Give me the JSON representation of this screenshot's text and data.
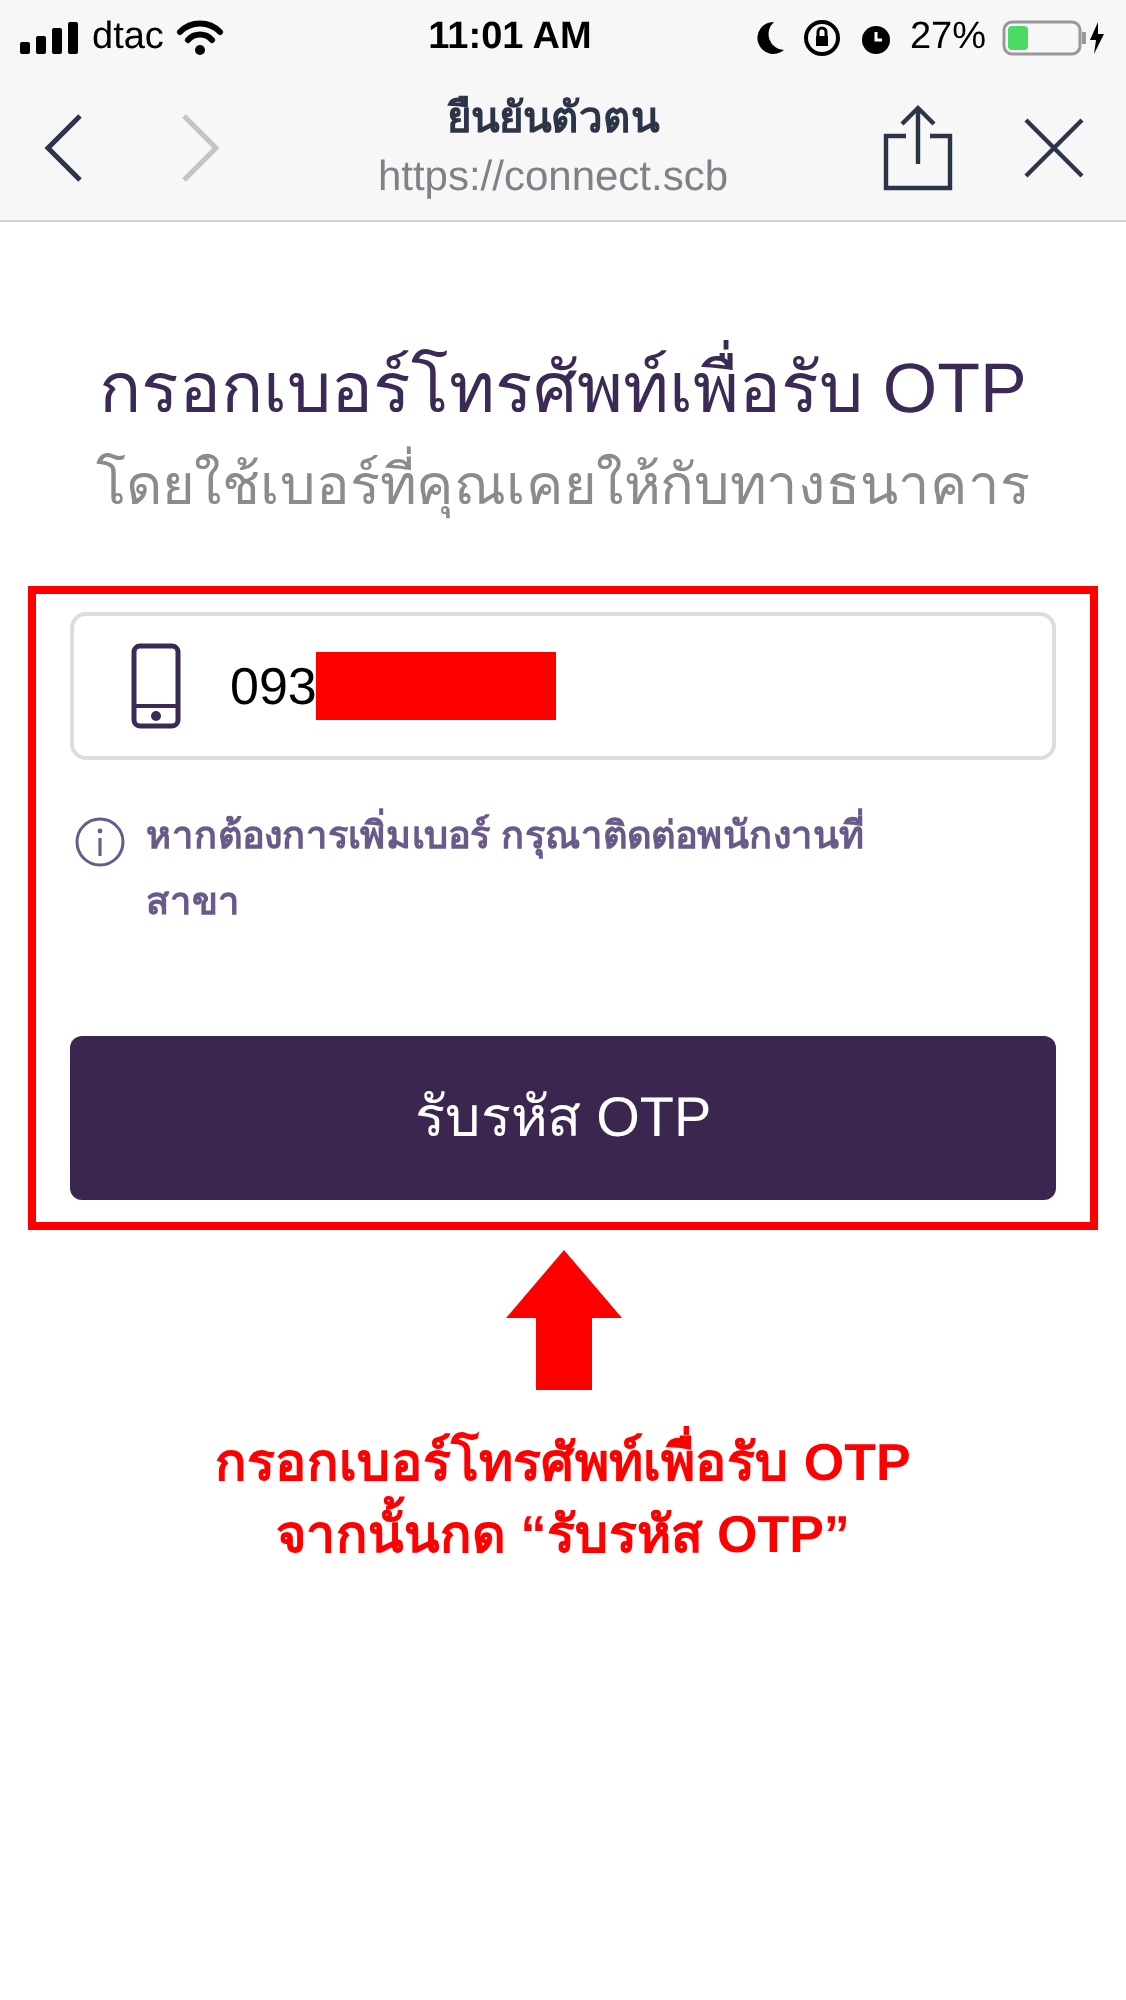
{
  "status_bar": {
    "carrier": "dtac",
    "time": "11:01 AM",
    "battery": "27%"
  },
  "browser_bar": {
    "title": "ยืนยันตัวตน",
    "url": "https://connect.scb"
  },
  "heading": "กรอกเบอร์โทรศัพท์เพื่อรับ OTP",
  "subheading": "โดยใช้เบอร์ที่คุณเคยให้กับทางธนาคาร",
  "phone_field": {
    "value": "093",
    "redacted": true
  },
  "info_note": "หากต้องการเพิ่มเบอร์ กรุณาติดต่อพนักงานที่สาขา",
  "submit_button": "รับรหัส OTP",
  "annotation": {
    "lines": [
      "กรอกเบอร์โทรศัพท์เพื่อรับ OTP",
      "จากนั้นกด “รับรหัส OTP”"
    ]
  }
}
